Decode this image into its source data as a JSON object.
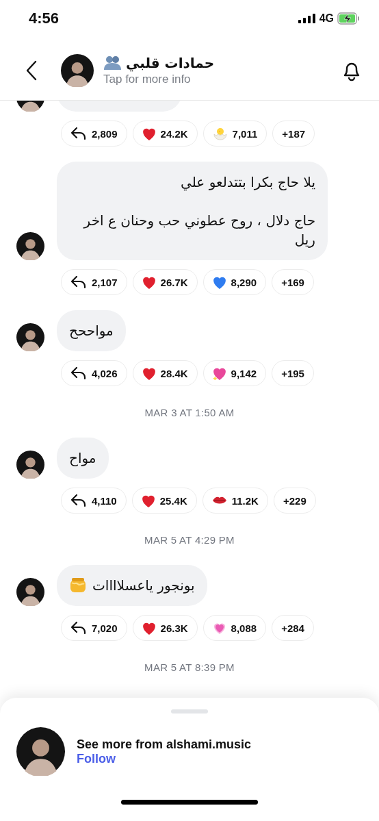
{
  "status_bar": {
    "time": "4:56",
    "network": "4G"
  },
  "header": {
    "title": "حمادات قلبي",
    "subtitle": "Tap for more info"
  },
  "feed": [
    {
      "kind": "message",
      "partial": true,
      "reactions": [
        {
          "kind": "reply",
          "count": "2,809"
        },
        {
          "kind": "heart",
          "color": "#e0202e",
          "count": "24.2K"
        },
        {
          "kind": "chick",
          "count": "7,011"
        },
        {
          "kind": "more",
          "count": "+187"
        }
      ]
    },
    {
      "kind": "message",
      "lines": [
        "يلا حاج بكرا بتتدلعو علي",
        "حاج دلال ، روح عطوني حب وحنان ع اخر ريل"
      ],
      "reactions": [
        {
          "kind": "reply",
          "count": "2,107"
        },
        {
          "kind": "heart",
          "color": "#e0202e",
          "count": "26.7K"
        },
        {
          "kind": "heart",
          "color": "#2f7cf0",
          "count": "8,290"
        },
        {
          "kind": "more",
          "count": "+169"
        }
      ]
    },
    {
      "kind": "message",
      "lines": [
        "مواححح"
      ],
      "reactions": [
        {
          "kind": "reply",
          "count": "4,026"
        },
        {
          "kind": "heart",
          "color": "#e0202e",
          "count": "28.4K"
        },
        {
          "kind": "sparkle-heart",
          "count": "9,142"
        },
        {
          "kind": "more",
          "count": "+195"
        }
      ]
    },
    {
      "kind": "timestamp",
      "text": "MAR 3 AT 1:50 AM"
    },
    {
      "kind": "message",
      "lines": [
        "مواح"
      ],
      "reactions": [
        {
          "kind": "reply",
          "count": "4,110"
        },
        {
          "kind": "heart",
          "color": "#e0202e",
          "count": "25.4K"
        },
        {
          "kind": "kiss",
          "count": "11.2K"
        },
        {
          "kind": "more",
          "count": "+229"
        }
      ]
    },
    {
      "kind": "timestamp",
      "text": "MAR 5 AT 4:29 PM"
    },
    {
      "kind": "emoji-message",
      "lines": [
        "بونجور ياعسلاااات"
      ],
      "reactions": [
        {
          "kind": "reply",
          "count": "7,020"
        },
        {
          "kind": "heart",
          "color": "#e0202e",
          "count": "26.3K"
        },
        {
          "kind": "glow-heart",
          "count": "8,088"
        },
        {
          "kind": "more",
          "count": "+284"
        }
      ]
    },
    {
      "kind": "timestamp",
      "text": "MAR 5 AT 8:39 PM"
    }
  ],
  "sheet": {
    "text": "See more from alshami.music",
    "link": "Follow"
  }
}
